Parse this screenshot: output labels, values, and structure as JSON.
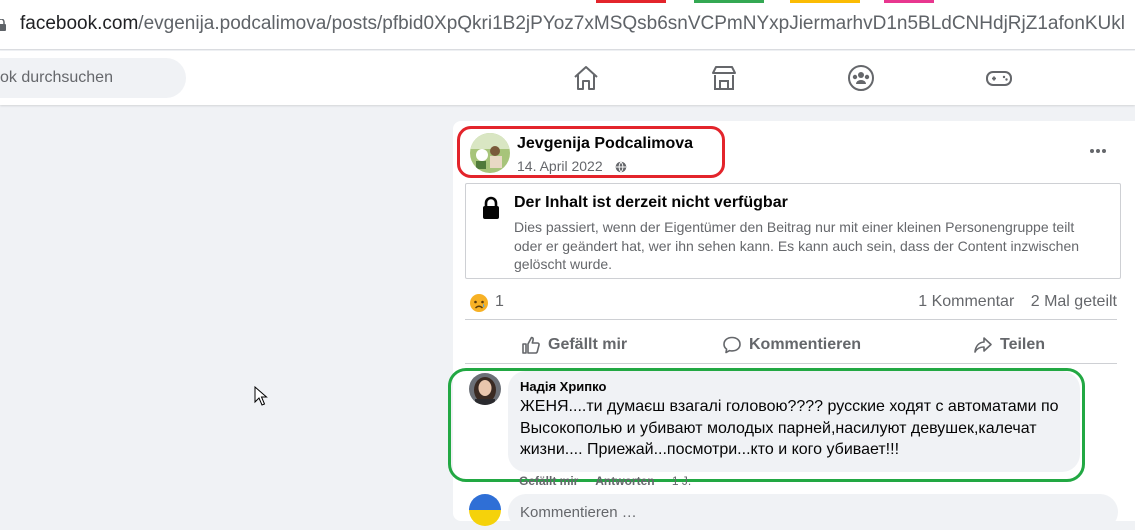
{
  "browser": {
    "url_host": "facebook.com",
    "url_path": "/evgenija.podcalimova/posts/pfbid0XpQkri1B2jPYoz7xMSQsb6snVCPmNYxpJiermarhvD1n5BLdCNHdjRjZ1afonKUkl"
  },
  "header": {
    "search_placeholder": "ok durchsuchen",
    "nav_icons": [
      "home-icon",
      "marketplace-icon",
      "groups-icon",
      "gaming-icon"
    ],
    "brand_color": "#1877f2"
  },
  "post": {
    "author": "Jevgenija Podcalimova",
    "date": "14. April 2022",
    "privacy_icon": "globe-icon",
    "more_icon": "more-dots-icon",
    "unavailable": {
      "title": "Der Inhalt ist derzeit nicht verfügbar",
      "text": "Dies passiert, wenn der Eigentümer den Beitrag nur mit einer kleinen Personengruppe teilt oder er geändert hat, wer ihn sehen kann. Es kann auch sein, dass der Content inzwischen gelöscht wurde."
    },
    "reaction_icon": "sad-reaction-icon",
    "reaction_count": "1",
    "comment_count": "1 Kommentar",
    "share_count": "2 Mal geteilt",
    "actions": {
      "like": "Gefällt mir",
      "comment": "Kommentieren",
      "share": "Teilen"
    }
  },
  "comment": {
    "author": "Надія Хрипко",
    "text": "ЖЕНЯ....ти думаєш взагалі головою???? русские ходят с автоматами по Высокополью и убивают молодых парней,насилуют девушек,калечат жизни.... Приежай...посмотри...кто и кого убивает!!!",
    "like": "Gefällt mir",
    "reply": "Antworten",
    "age": "1 J."
  },
  "write_comment": {
    "placeholder": "Kommentieren …"
  },
  "annotations": {
    "red_highlight_color": "#e3242b",
    "green_highlight_color": "#22a843"
  }
}
